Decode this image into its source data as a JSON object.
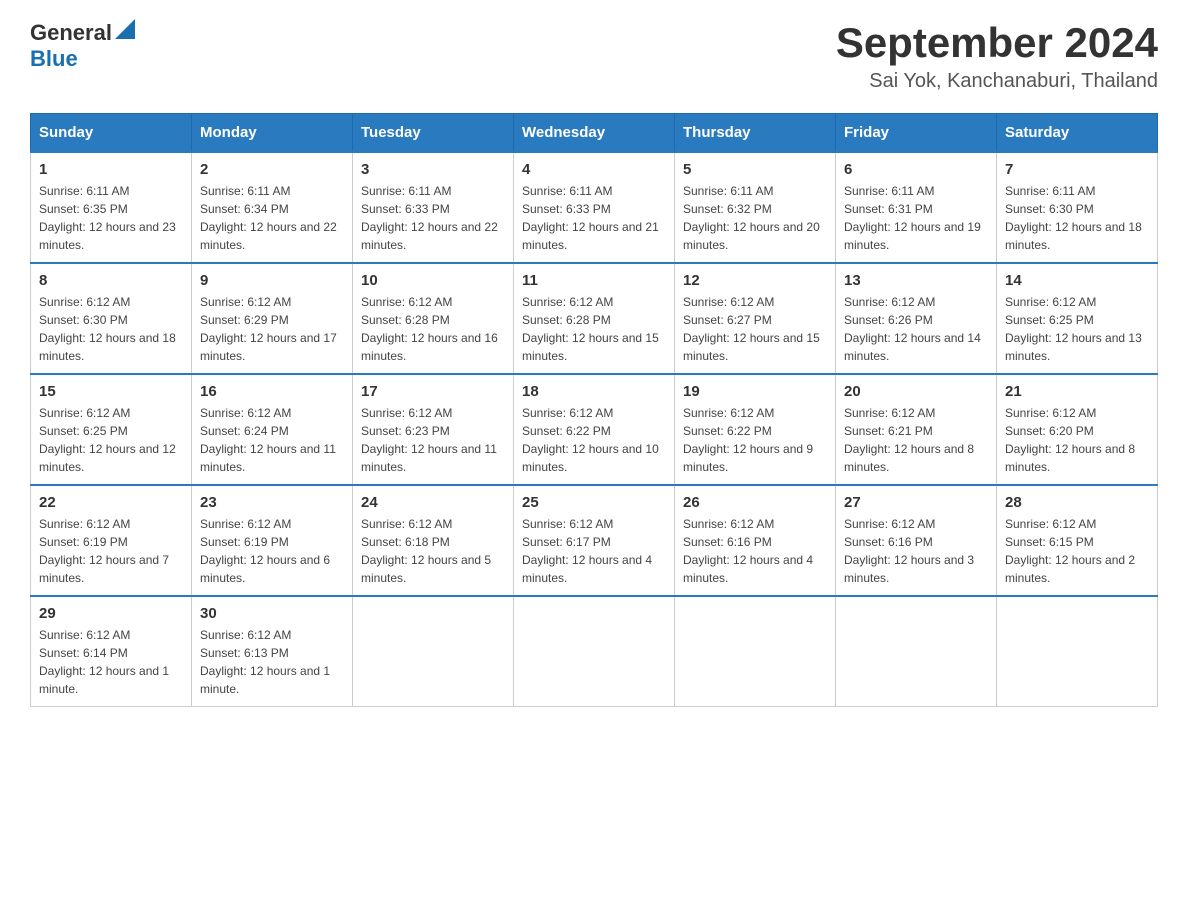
{
  "header": {
    "logo_general": "General",
    "logo_blue": "Blue",
    "title": "September 2024",
    "subtitle": "Sai Yok, Kanchanaburi, Thailand"
  },
  "days_of_week": [
    "Sunday",
    "Monday",
    "Tuesday",
    "Wednesday",
    "Thursday",
    "Friday",
    "Saturday"
  ],
  "weeks": [
    [
      {
        "day": "1",
        "sunrise": "Sunrise: 6:11 AM",
        "sunset": "Sunset: 6:35 PM",
        "daylight": "Daylight: 12 hours and 23 minutes."
      },
      {
        "day": "2",
        "sunrise": "Sunrise: 6:11 AM",
        "sunset": "Sunset: 6:34 PM",
        "daylight": "Daylight: 12 hours and 22 minutes."
      },
      {
        "day": "3",
        "sunrise": "Sunrise: 6:11 AM",
        "sunset": "Sunset: 6:33 PM",
        "daylight": "Daylight: 12 hours and 22 minutes."
      },
      {
        "day": "4",
        "sunrise": "Sunrise: 6:11 AM",
        "sunset": "Sunset: 6:33 PM",
        "daylight": "Daylight: 12 hours and 21 minutes."
      },
      {
        "day": "5",
        "sunrise": "Sunrise: 6:11 AM",
        "sunset": "Sunset: 6:32 PM",
        "daylight": "Daylight: 12 hours and 20 minutes."
      },
      {
        "day": "6",
        "sunrise": "Sunrise: 6:11 AM",
        "sunset": "Sunset: 6:31 PM",
        "daylight": "Daylight: 12 hours and 19 minutes."
      },
      {
        "day": "7",
        "sunrise": "Sunrise: 6:11 AM",
        "sunset": "Sunset: 6:30 PM",
        "daylight": "Daylight: 12 hours and 18 minutes."
      }
    ],
    [
      {
        "day": "8",
        "sunrise": "Sunrise: 6:12 AM",
        "sunset": "Sunset: 6:30 PM",
        "daylight": "Daylight: 12 hours and 18 minutes."
      },
      {
        "day": "9",
        "sunrise": "Sunrise: 6:12 AM",
        "sunset": "Sunset: 6:29 PM",
        "daylight": "Daylight: 12 hours and 17 minutes."
      },
      {
        "day": "10",
        "sunrise": "Sunrise: 6:12 AM",
        "sunset": "Sunset: 6:28 PM",
        "daylight": "Daylight: 12 hours and 16 minutes."
      },
      {
        "day": "11",
        "sunrise": "Sunrise: 6:12 AM",
        "sunset": "Sunset: 6:28 PM",
        "daylight": "Daylight: 12 hours and 15 minutes."
      },
      {
        "day": "12",
        "sunrise": "Sunrise: 6:12 AM",
        "sunset": "Sunset: 6:27 PM",
        "daylight": "Daylight: 12 hours and 15 minutes."
      },
      {
        "day": "13",
        "sunrise": "Sunrise: 6:12 AM",
        "sunset": "Sunset: 6:26 PM",
        "daylight": "Daylight: 12 hours and 14 minutes."
      },
      {
        "day": "14",
        "sunrise": "Sunrise: 6:12 AM",
        "sunset": "Sunset: 6:25 PM",
        "daylight": "Daylight: 12 hours and 13 minutes."
      }
    ],
    [
      {
        "day": "15",
        "sunrise": "Sunrise: 6:12 AM",
        "sunset": "Sunset: 6:25 PM",
        "daylight": "Daylight: 12 hours and 12 minutes."
      },
      {
        "day": "16",
        "sunrise": "Sunrise: 6:12 AM",
        "sunset": "Sunset: 6:24 PM",
        "daylight": "Daylight: 12 hours and 11 minutes."
      },
      {
        "day": "17",
        "sunrise": "Sunrise: 6:12 AM",
        "sunset": "Sunset: 6:23 PM",
        "daylight": "Daylight: 12 hours and 11 minutes."
      },
      {
        "day": "18",
        "sunrise": "Sunrise: 6:12 AM",
        "sunset": "Sunset: 6:22 PM",
        "daylight": "Daylight: 12 hours and 10 minutes."
      },
      {
        "day": "19",
        "sunrise": "Sunrise: 6:12 AM",
        "sunset": "Sunset: 6:22 PM",
        "daylight": "Daylight: 12 hours and 9 minutes."
      },
      {
        "day": "20",
        "sunrise": "Sunrise: 6:12 AM",
        "sunset": "Sunset: 6:21 PM",
        "daylight": "Daylight: 12 hours and 8 minutes."
      },
      {
        "day": "21",
        "sunrise": "Sunrise: 6:12 AM",
        "sunset": "Sunset: 6:20 PM",
        "daylight": "Daylight: 12 hours and 8 minutes."
      }
    ],
    [
      {
        "day": "22",
        "sunrise": "Sunrise: 6:12 AM",
        "sunset": "Sunset: 6:19 PM",
        "daylight": "Daylight: 12 hours and 7 minutes."
      },
      {
        "day": "23",
        "sunrise": "Sunrise: 6:12 AM",
        "sunset": "Sunset: 6:19 PM",
        "daylight": "Daylight: 12 hours and 6 minutes."
      },
      {
        "day": "24",
        "sunrise": "Sunrise: 6:12 AM",
        "sunset": "Sunset: 6:18 PM",
        "daylight": "Daylight: 12 hours and 5 minutes."
      },
      {
        "day": "25",
        "sunrise": "Sunrise: 6:12 AM",
        "sunset": "Sunset: 6:17 PM",
        "daylight": "Daylight: 12 hours and 4 minutes."
      },
      {
        "day": "26",
        "sunrise": "Sunrise: 6:12 AM",
        "sunset": "Sunset: 6:16 PM",
        "daylight": "Daylight: 12 hours and 4 minutes."
      },
      {
        "day": "27",
        "sunrise": "Sunrise: 6:12 AM",
        "sunset": "Sunset: 6:16 PM",
        "daylight": "Daylight: 12 hours and 3 minutes."
      },
      {
        "day": "28",
        "sunrise": "Sunrise: 6:12 AM",
        "sunset": "Sunset: 6:15 PM",
        "daylight": "Daylight: 12 hours and 2 minutes."
      }
    ],
    [
      {
        "day": "29",
        "sunrise": "Sunrise: 6:12 AM",
        "sunset": "Sunset: 6:14 PM",
        "daylight": "Daylight: 12 hours and 1 minute."
      },
      {
        "day": "30",
        "sunrise": "Sunrise: 6:12 AM",
        "sunset": "Sunset: 6:13 PM",
        "daylight": "Daylight: 12 hours and 1 minute."
      },
      null,
      null,
      null,
      null,
      null
    ]
  ]
}
